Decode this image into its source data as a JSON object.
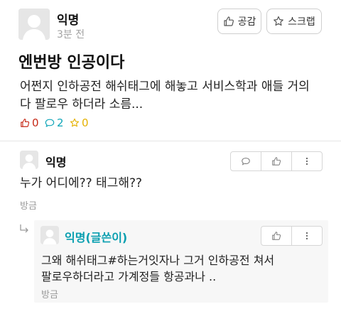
{
  "post": {
    "author": "익명",
    "time": "3분 전",
    "like_label": "공감",
    "scrap_label": "스크랩",
    "title": "엔번방 인공이다",
    "body_line1": "어쩐지 인하공전 해쉬태그에 해놓고 서비스학과 애들 거의",
    "body_line2": "다 팔로우 하더라 소름...",
    "likes": "0",
    "comments": "2",
    "scraps": "0"
  },
  "comment": {
    "author": "익명",
    "text": "누가 어디에?? 태그해??",
    "reply_label": "방금"
  },
  "reply": {
    "author": "익명(글쓴이)",
    "text_line1": "그왜 해쉬태그#하는거잇자나 그거 인하공전 쳐서",
    "text_line2": "팔로우하더라고 가계정들 항공과나 ..",
    "reply_label": "방금"
  },
  "colors": {
    "like": "#c62917",
    "comment": "#0ea5b8",
    "scrap": "#e5b100",
    "op_author": "#0a9fb0"
  },
  "icons": [
    "thumb-up-icon",
    "star-icon",
    "speech-bubble-icon",
    "kebab-menu-icon",
    "reply-arrow-icon",
    "avatar-icon"
  ]
}
